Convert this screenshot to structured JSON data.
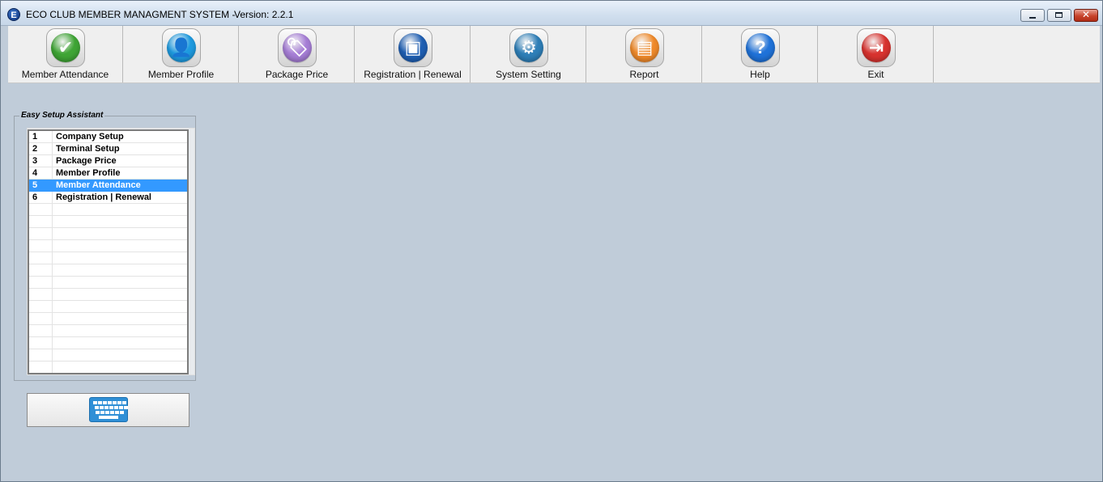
{
  "window": {
    "title": "ECO CLUB MEMBER MANAGMENT SYSTEM -",
    "version": "Version: 2.2.1",
    "app_icon_letter": "E",
    "controls": [
      "minimize-icon",
      "maximize-icon",
      "close-icon"
    ]
  },
  "toolbar": {
    "items": [
      {
        "label": "Member Attendance",
        "icon": "checkmark-icon",
        "color": "#3fa535",
        "glyph": "✔"
      },
      {
        "label": "Member Profile",
        "icon": "user-icon",
        "color": "#1e9be0",
        "glyph": "👤"
      },
      {
        "label": "Package Price",
        "icon": "price-tag-icon",
        "color": "#a67ed6",
        "glyph": "🏷"
      },
      {
        "label": "Registration | Renewal",
        "icon": "id-card-icon",
        "color": "#1f5fb3",
        "glyph": "▣"
      },
      {
        "label": "System Setting",
        "icon": "gear-icon",
        "color": "#2e7fb8",
        "glyph": "⚙"
      },
      {
        "label": "Report",
        "icon": "report-icon",
        "color": "#f08a2a",
        "glyph": "▤"
      },
      {
        "label": "Help",
        "icon": "help-icon",
        "color": "#1f72d9",
        "glyph": "?"
      },
      {
        "label": "Exit",
        "icon": "exit-icon",
        "color": "#d8332f",
        "glyph": "⇥"
      }
    ]
  },
  "setup_assistant": {
    "title": "Easy Setup Assistant",
    "selected_index": 4,
    "items": [
      {
        "num": "1",
        "label": "Company Setup"
      },
      {
        "num": "2",
        "label": "Terminal Setup"
      },
      {
        "num": "3",
        "label": "Package Price"
      },
      {
        "num": "4",
        "label": "Member Profile"
      },
      {
        "num": "5",
        "label": "Member Attendance"
      },
      {
        "num": "6",
        "label": "Registration | Renewal"
      }
    ]
  },
  "keyboard_button": {
    "icon": "keyboard-icon"
  }
}
